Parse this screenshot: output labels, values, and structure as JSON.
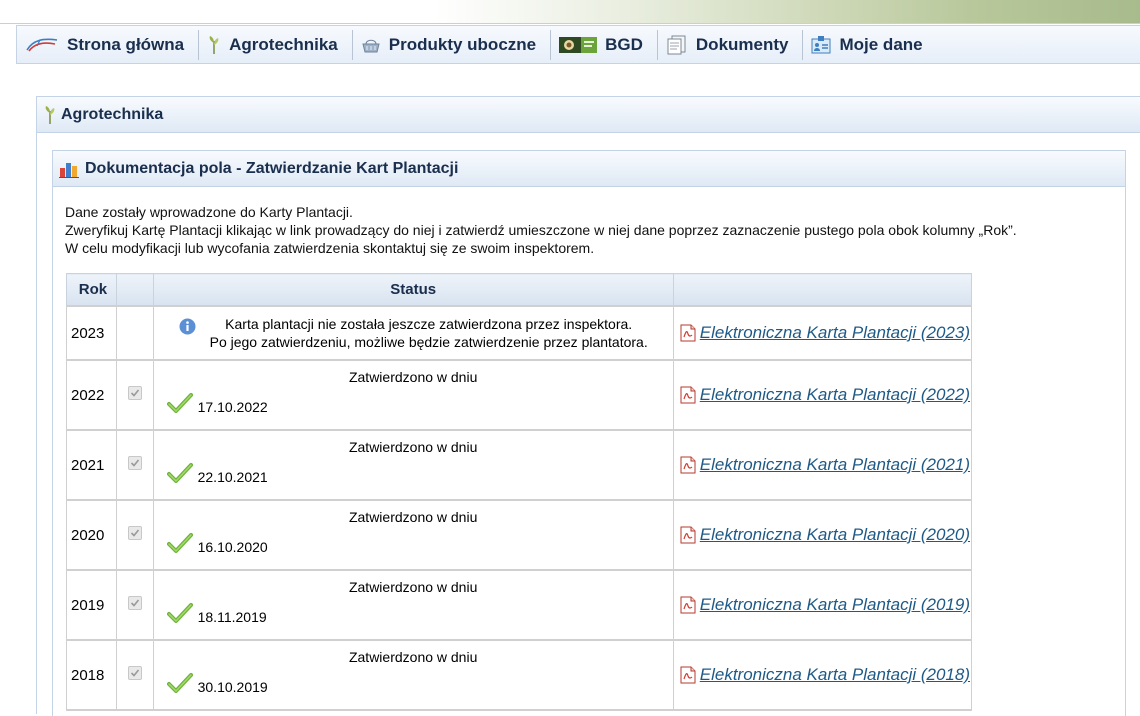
{
  "nav": {
    "items": [
      {
        "label": "Strona główna",
        "icon": "swoosh-logo-icon"
      },
      {
        "label": "Agrotechnika",
        "icon": "plant-icon"
      },
      {
        "label": "Produkty uboczne",
        "icon": "basket-icon"
      },
      {
        "label": "BGD",
        "icon": "bgd-logo-icon"
      },
      {
        "label": "Dokumenty",
        "icon": "documents-icon"
      },
      {
        "label": "Moje dane",
        "icon": "id-card-icon"
      }
    ]
  },
  "section": {
    "title": "Agrotechnika",
    "icon": "plant-icon"
  },
  "subsection": {
    "title": "Dokumentacja pola - Zatwierdzanie Kart Plantacji",
    "icon": "bar-chart-icon"
  },
  "description": {
    "line1": "Dane zostały wprowadzone do Karty Plantacji.",
    "line2": "Zweryfikuj Kartę Plantacji klikając w link prowadzący do niej i zatwierdź umieszczone w niej dane poprzez zaznaczenie pustego pola obok kolumny „Rok”.",
    "line3": "W celu modyfikacji lub wycofania zatwierdzenia skontaktuj się ze swoim inspektorem."
  },
  "table": {
    "headers": {
      "rok": "Rok",
      "check": "",
      "status": "Status",
      "link": ""
    },
    "pending_row": {
      "year": "2023",
      "status_line1": "Karta plantacji nie została jeszcze zatwierdzona przez inspektora.",
      "status_line2": "Po jego zatwierdzeniu, możliwe będzie zatwierdzenie przez plantatora.",
      "link": "Elektroniczna Karta Plantacji (2023)"
    },
    "approved_label": "Zatwierdzono w dniu",
    "rows": [
      {
        "year": "2022",
        "date": "17.10.2022",
        "link": "Elektroniczna Karta Plantacji (2022)",
        "checked": true
      },
      {
        "year": "2021",
        "date": "22.10.2021",
        "link": "Elektroniczna Karta Plantacji (2021)",
        "checked": true
      },
      {
        "year": "2020",
        "date": "16.10.2020",
        "link": "Elektroniczna Karta Plantacji (2020)",
        "checked": true
      },
      {
        "year": "2019",
        "date": "18.11.2019",
        "link": "Elektroniczna Karta Plantacji (2019)",
        "checked": true
      },
      {
        "year": "2018",
        "date": "30.10.2019",
        "link": "Elektroniczna Karta Plantacji (2018)",
        "checked": true
      }
    ]
  }
}
